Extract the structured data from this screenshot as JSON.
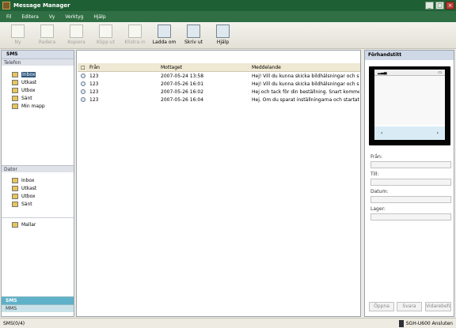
{
  "window": {
    "title": "Message Manager",
    "controls": [
      "_",
      "□",
      "×"
    ]
  },
  "menu": [
    "Fil",
    "Editera",
    "Vy",
    "Verktyg",
    "Hjälp"
  ],
  "toolbar": [
    {
      "label": "Ny",
      "enabled": false,
      "icon": "new-message-icon"
    },
    {
      "label": "Radera",
      "enabled": false,
      "icon": "delete-icon"
    },
    {
      "label": "Kopiera",
      "enabled": false,
      "icon": "copy-icon"
    },
    {
      "label": "Klipp ut",
      "enabled": false,
      "icon": "cut-icon"
    },
    {
      "label": "Klistra in",
      "enabled": false,
      "icon": "paste-icon"
    },
    {
      "label": "Ladda om",
      "enabled": true,
      "icon": "reload-icon"
    },
    {
      "label": "Skriv ut",
      "enabled": true,
      "icon": "print-icon"
    },
    {
      "label": "Hjälp",
      "enabled": true,
      "icon": "help-icon"
    }
  ],
  "sidebar": {
    "sms_header": "SMS",
    "telefon": "Telefon",
    "telefon_items": [
      "Inbox",
      "Utkast",
      "Utbox",
      "Sänt",
      "Min mapp"
    ],
    "dator": "Dator",
    "dator_items": [
      "Inbox",
      "Utkast",
      "Utbox",
      "Sänt"
    ],
    "mallar": "Mallar",
    "tabs": [
      "SMS",
      "MMS"
    ]
  },
  "messages": {
    "headers": [
      "Från",
      "Mottaget",
      "Meddelande"
    ],
    "rows": [
      {
        "from": "123",
        "date": "2007-05-24 13:58",
        "message": "Hej! Vill du kunna skicka bildhälsningar och surfa..."
      },
      {
        "from": "123",
        "date": "2007-05-26 16:01",
        "message": "Hej! Vill du kunna skicka bildhälsningar och surfa..."
      },
      {
        "from": "123",
        "date": "2007-05-26 16:02",
        "message": "Hej och tack för din beställning. Snart kommer i..."
      },
      {
        "from": "123",
        "date": "2007-05-26 16:04",
        "message": "Hej. Om du sparat inställningarna och startat o..."
      }
    ]
  },
  "preview": {
    "title": "Förhandstitt",
    "fields": [
      "Från:",
      "Till:",
      "Datum:",
      "Lager:"
    ],
    "buttons": [
      "Öppna",
      "Svara",
      "Vidarebefordra"
    ]
  },
  "status": {
    "left": "SMS(0/4)",
    "right": "SGH-U600 Ansluten"
  },
  "colors": {
    "titlebar": "#1f5f34",
    "menubar": "#2f6f43",
    "selection": "#31597d",
    "active_tab": "#5eb1c8"
  }
}
